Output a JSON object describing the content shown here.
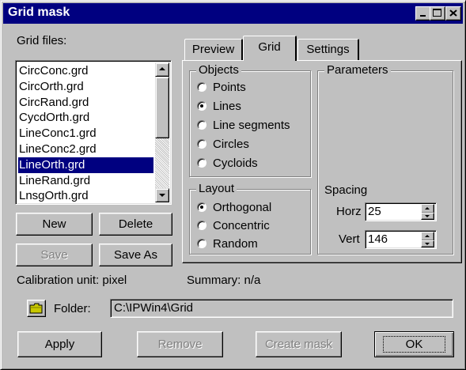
{
  "window": {
    "title": "Grid mask",
    "controls": {
      "minimize": "minimize-icon",
      "maximize": "maximize-icon",
      "close": "close-icon"
    }
  },
  "grid_files": {
    "label": "Grid files:",
    "items": [
      "CircConc.grd",
      "CircOrth.grd",
      "CircRand.grd",
      "CycdOrth.grd",
      "LineConc1.grd",
      "LineConc2.grd",
      "LineOrth.grd",
      "LineRand.grd",
      "LnsgOrth.grd"
    ],
    "selected": "LineOrth.grd"
  },
  "buttons": {
    "new": "New",
    "delete": "Delete",
    "save": "Save",
    "save_as": "Save As",
    "apply": "Apply",
    "remove": "Remove",
    "create_mask": "Create mask",
    "ok": "OK"
  },
  "tabs": {
    "preview": "Preview",
    "grid": "Grid",
    "settings": "Settings",
    "active": "Grid"
  },
  "objects": {
    "label": "Objects",
    "options": [
      "Points",
      "Lines",
      "Line segments",
      "Circles",
      "Cycloids"
    ],
    "selected": "Lines"
  },
  "layout": {
    "label": "Layout",
    "options": [
      "Orthogonal",
      "Concentric",
      "Random"
    ],
    "selected": "Orthogonal"
  },
  "parameters": {
    "label": "Parameters",
    "spacing_label": "Spacing",
    "horz_label": "Horz",
    "horz_value": "25",
    "vert_label": "Vert",
    "vert_value": "146"
  },
  "status": {
    "calibration": "Calibration unit: pixel",
    "summary": "Summary: n/a"
  },
  "folder": {
    "label": "Folder:",
    "path": "C:\\IPWin4\\Grid",
    "icon": "folder-icon"
  }
}
